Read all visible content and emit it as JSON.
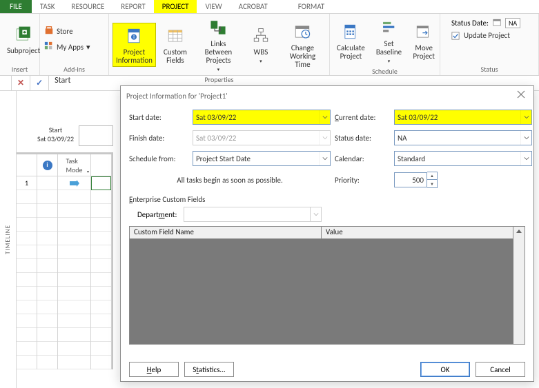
{
  "tabs": {
    "file": "FILE",
    "task": "TASK",
    "resource": "RESOURCE",
    "report": "REPORT",
    "project": "PROJECT",
    "view": "VIEW",
    "acrobat": "ACROBAT",
    "format": "FORMAT"
  },
  "ribbon": {
    "insert": {
      "subproject": "Subproject",
      "label": "Insert"
    },
    "addins": {
      "store": "Store",
      "myapps": "My Apps",
      "label": "Add-ins"
    },
    "properties": {
      "projectInfo": "Project\nInformation",
      "customFields": "Custom\nFields",
      "linksBetween": "Links Between\nProjects",
      "wbs": "WBS",
      "workingTime": "Change\nWorking Time",
      "label": "Properties"
    },
    "schedule": {
      "calculate": "Calculate\nProject",
      "baseline": "Set\nBaseline",
      "move": "Move\nProject",
      "label": "Schedule"
    },
    "status": {
      "statusDate": "Status Date:",
      "na": "NA",
      "update": "Update Project",
      "label": "Status"
    }
  },
  "quick": {
    "x": "✕",
    "check": "✓",
    "text": "Start"
  },
  "timeline": {
    "label": "TIMELINE",
    "start": "Start",
    "date": "Sat 03/09/22"
  },
  "columns": {
    "rownum": "1",
    "task": "Task\nMode"
  },
  "dialog": {
    "title": "Project Information for 'Project1'",
    "labels": {
      "startDate": "Start date:",
      "finishDate": "Finish date:",
      "scheduleFrom": "Schedule from:",
      "currentDate": "Current date:",
      "statusDate": "Status date:",
      "calendar": "Calendar:",
      "priority": "Priority:"
    },
    "values": {
      "startDate": "Sat 03/09/22",
      "finishDate": "Sat 03/09/22",
      "scheduleFrom": "Project Start Date",
      "currentDate": "Sat 03/09/22",
      "statusDate": "NA",
      "calendar": "Standard",
      "priority": "500"
    },
    "note": "All tasks begin as soon as possible.",
    "enterprise": "Enterprise Custom Fields",
    "department": "Department:",
    "custCols": {
      "name": "Custom Field Name",
      "value": "Value"
    },
    "buttons": {
      "help": "Help",
      "stats": "Statistics...",
      "ok": "OK",
      "cancel": "Cancel"
    }
  }
}
